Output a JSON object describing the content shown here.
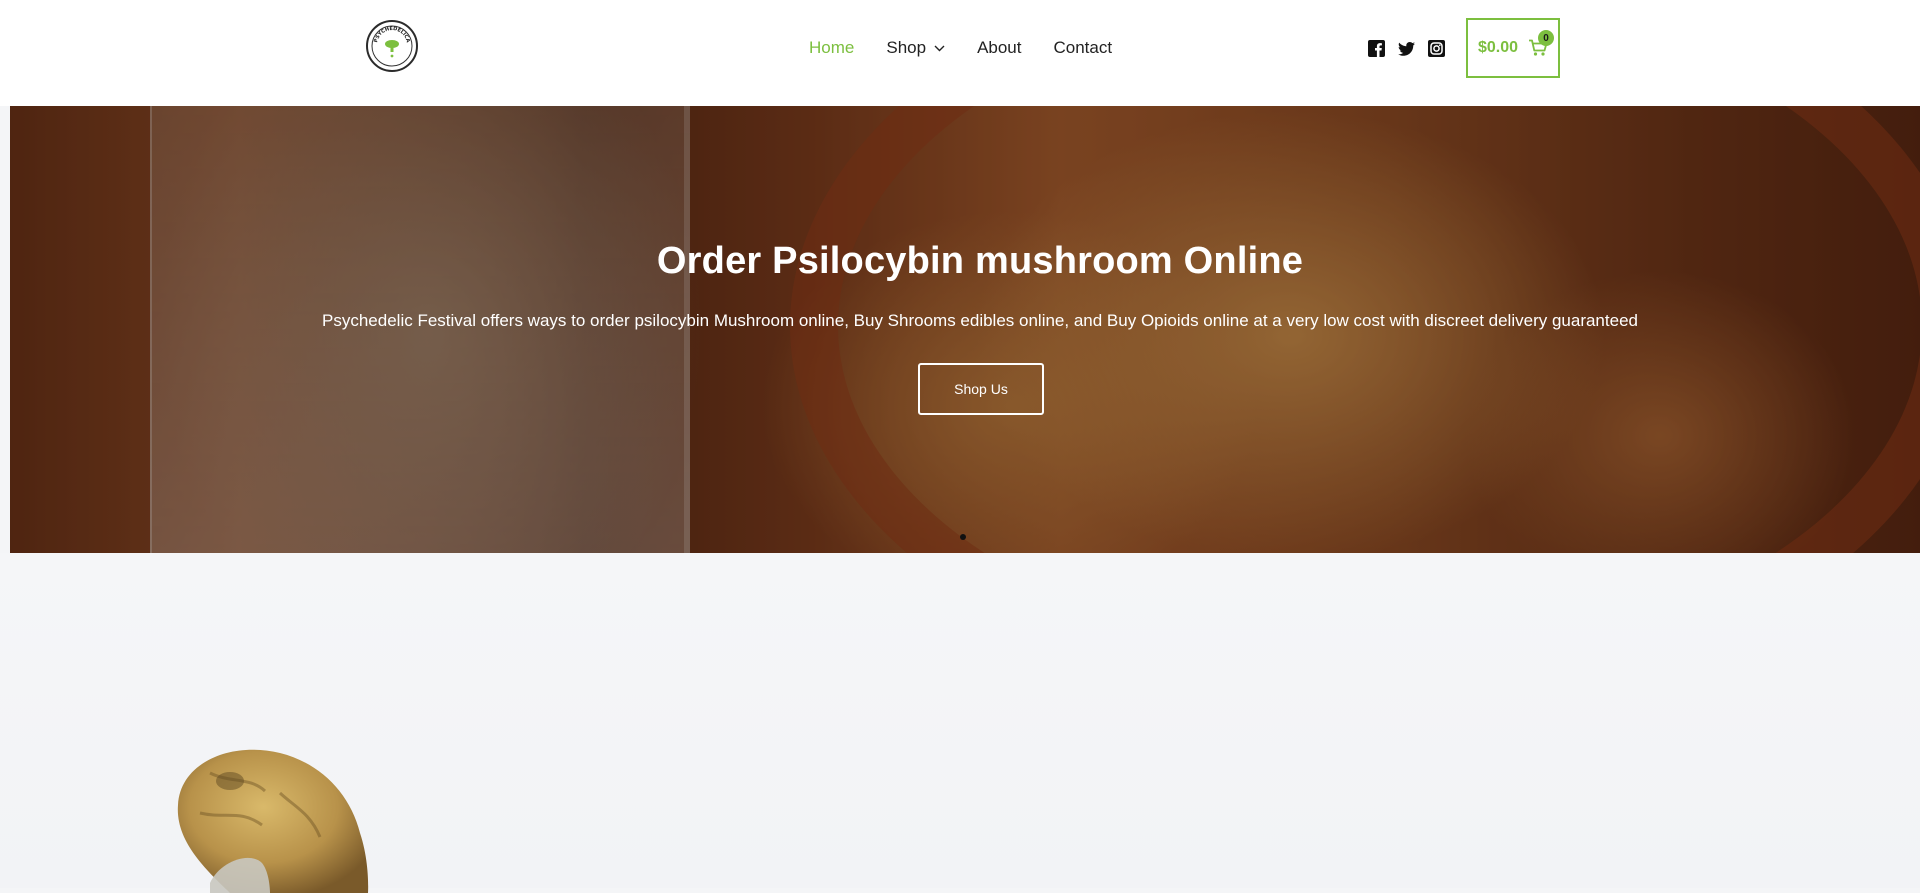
{
  "header": {
    "logo": {
      "alt": "Psychedelic Festival",
      "text": "PSYCHEDELICA"
    },
    "nav": [
      {
        "label": "Home",
        "active": true
      },
      {
        "label": "Shop",
        "has_dropdown": true
      },
      {
        "label": "About"
      },
      {
        "label": "Contact"
      }
    ],
    "socials": [
      "facebook-icon",
      "twitter-icon",
      "instagram-icon"
    ],
    "cart": {
      "total": "$0.00",
      "count": "0",
      "icon": "cart-icon"
    },
    "colors": {
      "accent": "#7cbf3f",
      "text": "#222222"
    }
  },
  "hero": {
    "title": "Order Psilocybin mushroom Online",
    "text": "Psychedelic Festival offers ways to order psilocybin Mushroom online, Buy Shrooms edibles online, and Buy Opioids online at a very low cost with discreet delivery guaranteed",
    "button_label": "Shop Us"
  }
}
